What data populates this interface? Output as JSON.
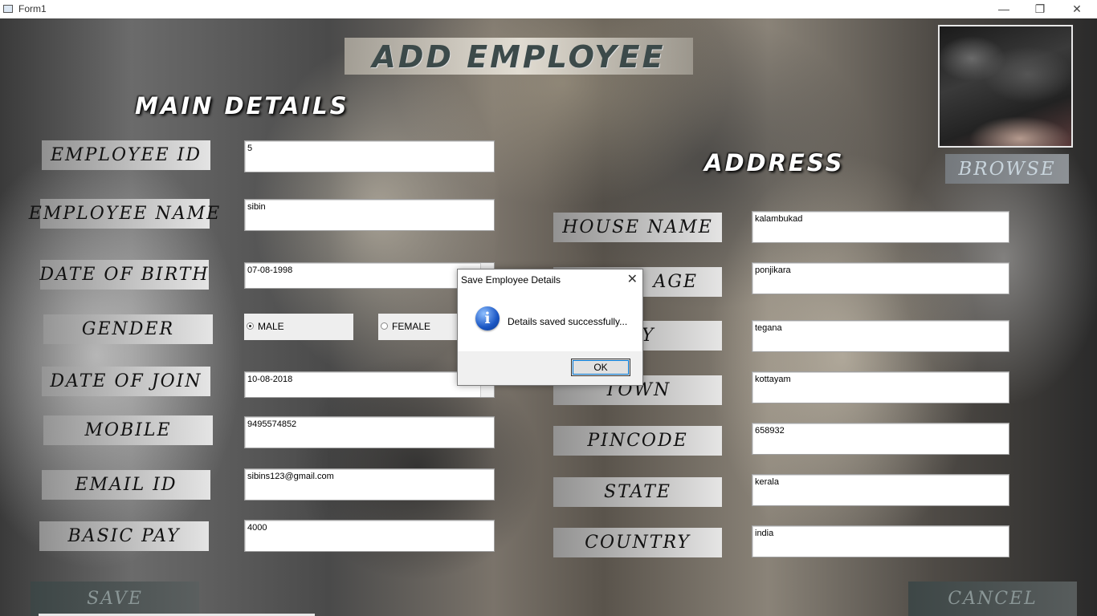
{
  "window": {
    "title": "Form1",
    "minimize": "—",
    "restore": "❐",
    "close": "✕"
  },
  "header": {
    "title": "ADD EMPLOYEE"
  },
  "main_details": {
    "heading": "MAIN DETAILS",
    "employee_id_label": "EMPLOYEE ID",
    "employee_id": "5",
    "employee_name_label": "EMPLOYEE NAME",
    "employee_name": "sibin",
    "dob_label": "DATE OF BIRTH",
    "dob": "07-08-1998",
    "gender_label": "GENDER",
    "gender_male": "MALE",
    "gender_female": "FEMALE",
    "doj_label": "DATE OF JOIN",
    "doj": "10-08-2018",
    "mobile_label": "MOBILE",
    "mobile": "9495574852",
    "email_label": "EMAIL ID",
    "email": "sibins123@gmail.com",
    "basic_pay_label": "BASIC PAY",
    "basic_pay": "4000"
  },
  "address": {
    "heading": "ADDRESS",
    "house_label": "HOUSE NAME",
    "house": "kalambukad",
    "village_label": "AGE",
    "village": "ponjikara",
    "city_label": "Y",
    "city": "tegana",
    "town_label": "TOWN",
    "town": "kottayam",
    "pincode_label": "PINCODE",
    "pincode": "658932",
    "state_label": "STATE",
    "state": "kerala",
    "country_label": "COUNTRY",
    "country": "india"
  },
  "photo": {
    "browse_label": "BROWSE"
  },
  "actions": {
    "save_label": "SAVE",
    "cancel_label": "CANCEL"
  },
  "dialog": {
    "title": "Save Employee Details",
    "message": "Details saved successfully...",
    "ok_label": "OK",
    "close": "✕",
    "icon": "i"
  }
}
